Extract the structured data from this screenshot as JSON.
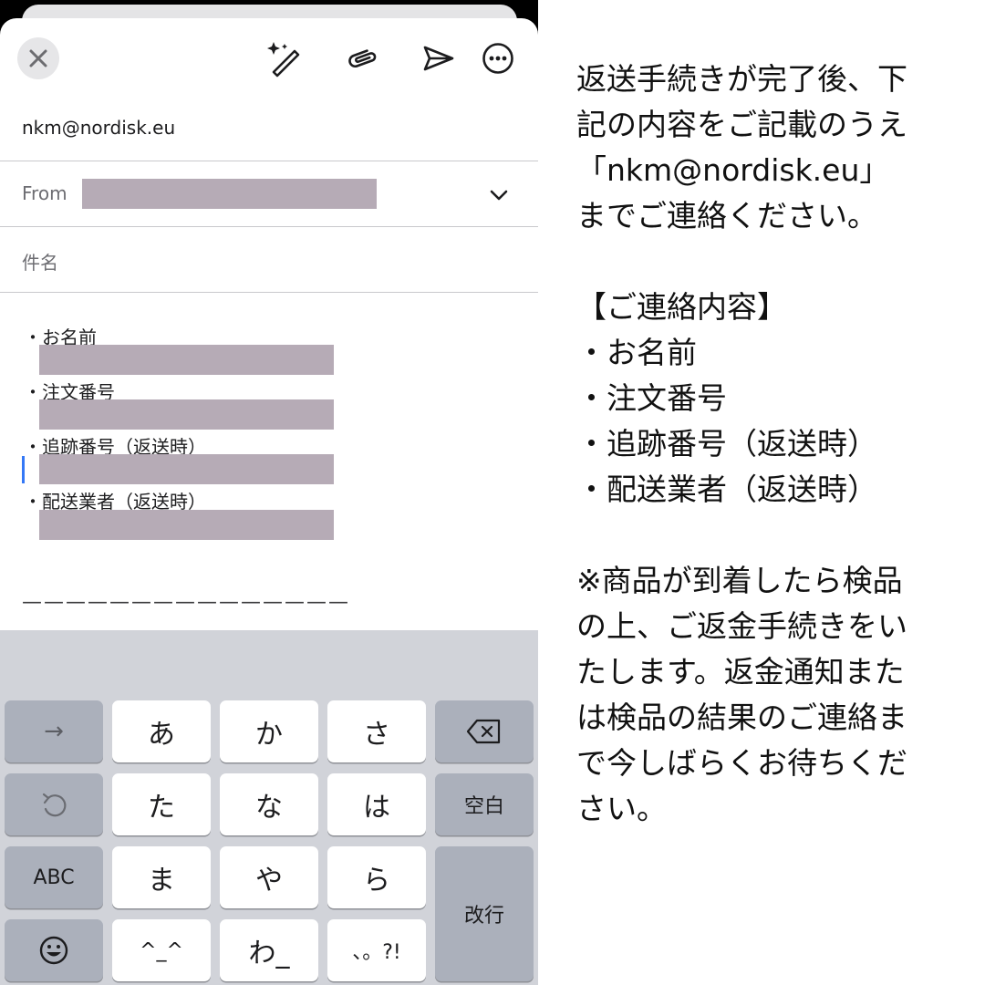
{
  "compose": {
    "to_address": "nkm@nordisk.eu",
    "from_label": "From",
    "subject_label": "件名",
    "body_lines": [
      "・お名前",
      "・注文番号",
      "・追跡番号（返送時）",
      "・配送業者（返送時）"
    ],
    "separator": "———————————————",
    "toolbar_icons": [
      "close-icon",
      "magic-wand-icon",
      "paperclip-icon",
      "send-icon",
      "more-icon"
    ],
    "redaction_color": "#b6abb6",
    "cursor_color": "#3478f6"
  },
  "keyboard": {
    "rows": [
      [
        "→",
        "あ",
        "か",
        "さ",
        "⌫"
      ],
      [
        "↺",
        "た",
        "な",
        "は",
        "空白"
      ],
      [
        "ABC",
        "ま",
        "や",
        "ら",
        "改行"
      ],
      [
        "☺",
        "^^",
        "わ",
        "、。?!"
      ]
    ],
    "key_labels": {
      "arrow": "→",
      "a": "あ",
      "ka": "か",
      "sa": "さ",
      "ta": "た",
      "na": "な",
      "ha": "は",
      "space": "空白",
      "abc": "ABC",
      "ma": "ま",
      "ya": "や",
      "ra": "ら",
      "enter": "改行",
      "kaomoji": "^_^",
      "wa": "わ_",
      "punct": "、。?!"
    },
    "icons": [
      "undo-icon",
      "backspace-icon",
      "emoji-icon"
    ]
  },
  "notes": {
    "paragraph1": "返送手続きが完了後、下\n記の内容をご記載のうえ\n「nkm@nordisk.eu」\nまでご連絡ください。",
    "section_title": "【ご連絡内容】",
    "items": [
      "・お名前",
      "・注文番号",
      "・追跡番号（返送時）",
      "・配送業者（返送時）"
    ],
    "paragraph2": "※商品が到着したら検品\nの上、ご返金手続きをい\nたします。返金通知また\nは検品の結果のご連絡ま\nで今しばらくお待ちくだ\nさい。"
  }
}
